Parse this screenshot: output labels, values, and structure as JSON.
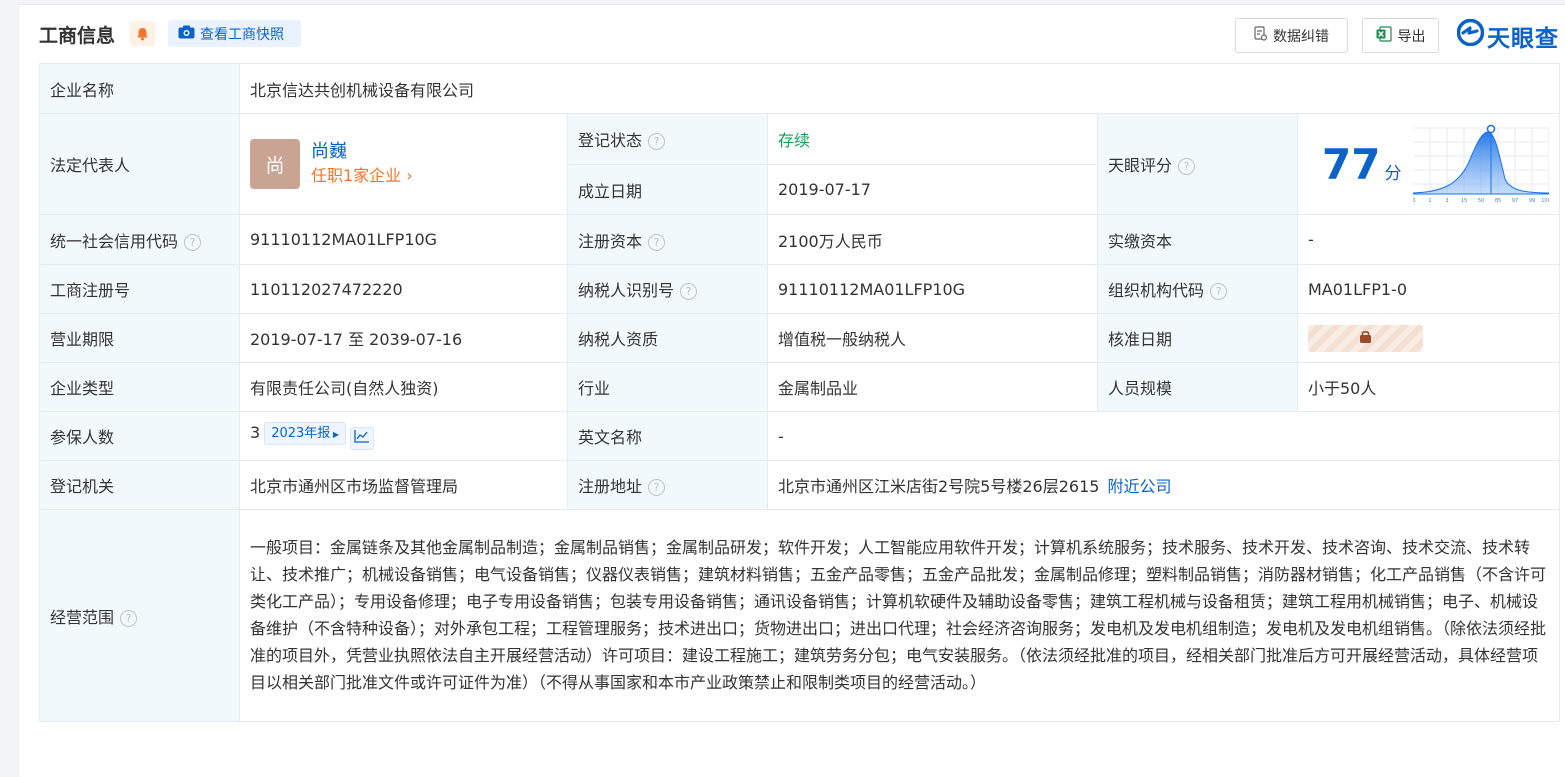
{
  "header": {
    "title": "工商信息",
    "snapshot_label": "查看工商快照",
    "correct_label": "数据纠错",
    "export_label": "导出",
    "brand_name": "天眼查"
  },
  "rows": {
    "company_name": {
      "label": "企业名称",
      "value": "北京信达共创机械设备有限公司"
    },
    "legal_rep": {
      "label": "法定代表人",
      "avatar_char": "尚",
      "name": "尚巍",
      "link": "任职1家企业"
    },
    "reg_status": {
      "label": "登记状态",
      "value": "存续"
    },
    "found_date": {
      "label": "成立日期",
      "value": "2019-07-17"
    },
    "tianyan_score": {
      "label": "天眼评分",
      "value": "77",
      "unit": "分",
      "dist_ticks": [
        "0",
        "1",
        "3",
        "15",
        "50",
        "85",
        "97",
        "99",
        "100"
      ]
    },
    "credit_code": {
      "label": "统一社会信用代码",
      "value": "91110112MA01LFP10G"
    },
    "reg_capital": {
      "label": "注册资本",
      "value": "2100万人民币"
    },
    "paid_capital": {
      "label": "实缴资本",
      "value": "-"
    },
    "reg_number": {
      "label": "工商注册号",
      "value": "110112027472220"
    },
    "taxpayer_id": {
      "label": "纳税人识别号",
      "value": "91110112MA01LFP10G"
    },
    "org_code": {
      "label": "组织机构代码",
      "value": "MA01LFP1-0"
    },
    "biz_term": {
      "label": "营业期限",
      "value": "2019-07-17 至 2039-07-16"
    },
    "taxpayer_qual": {
      "label": "纳税人资质",
      "value": "增值税一般纳税人"
    },
    "approve_date": {
      "label": "核准日期"
    },
    "company_type": {
      "label": "企业类型",
      "value": "有限责任公司(自然人独资)"
    },
    "industry": {
      "label": "行业",
      "value": "金属制品业"
    },
    "staff_size": {
      "label": "人员规模",
      "value": "小于50人"
    },
    "insured": {
      "label": "参保人数",
      "value": "3",
      "report": "2023年报"
    },
    "english_name": {
      "label": "英文名称",
      "value": "-"
    },
    "reg_authority": {
      "label": "登记机关",
      "value": "北京市通州区市场监督管理局"
    },
    "reg_address": {
      "label": "注册地址",
      "value": "北京市通州区江米店街2号院5号楼26层2615",
      "nearby": "附近公司"
    },
    "biz_scope": {
      "label": "经营范围",
      "value": "一般项目：金属链条及其他金属制品制造；金属制品销售；金属制品研发；软件开发；人工智能应用软件开发；计算机系统服务；技术服务、技术开发、技术咨询、技术交流、技术转让、技术推广；机械设备销售；电气设备销售；仪器仪表销售；建筑材料销售；五金产品零售；五金产品批发；金属制品修理；塑料制品销售；消防器材销售；化工产品销售（不含许可类化工产品）；专用设备修理；电子专用设备销售；包装专用设备销售；通讯设备销售；计算机软硬件及辅助设备零售；建筑工程机械与设备租赁；建筑工程用机械销售；电子、机械设备维护（不含特种设备）；对外承包工程；工程管理服务；技术进出口；货物进出口；进出口代理；社会经济咨询服务；发电机及发电机组制造；发电机及发电机组销售。（除依法须经批准的项目外，凭营业执照依法自主开展经营活动）许可项目：建设工程施工；建筑劳务分包；电气安装服务。（依法须经批准的项目，经相关部门批准后方可开展经营活动，具体经营项目以相关部门批准文件或许可证件为准）（不得从事国家和本市产业政策禁止和限制类项目的经营活动。）"
    }
  },
  "colors": {
    "accent": "#0b62c8",
    "label_bg": "#f2f9fc",
    "status_green": "#11a353",
    "link_orange": "#f0772a"
  }
}
